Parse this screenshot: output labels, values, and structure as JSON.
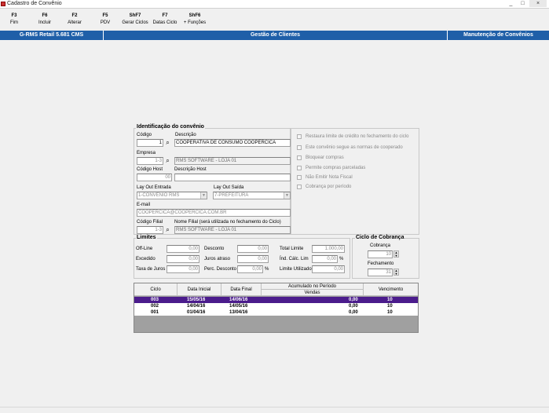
{
  "window": {
    "title": "Cadastro de Convênio",
    "controls": [
      "_",
      "□",
      "×"
    ]
  },
  "toolbar": [
    {
      "key": "F3",
      "label": "Fim"
    },
    {
      "key": "F6",
      "label": "Incluir"
    },
    {
      "key": "F2",
      "label": "Alterar"
    },
    {
      "key": "F5",
      "label": "PDV"
    },
    {
      "key": "ShF7",
      "label": "Gerar Ciclos"
    },
    {
      "key": "F7",
      "label": "Datas Ciclo"
    },
    {
      "key": "ShF6",
      "label": "+ Funções"
    }
  ],
  "bluebar": {
    "app": "G-RMS Retail 5.681 CMS",
    "module": "Gestão de Clientes",
    "screen": "Manutenção de Convênios"
  },
  "ident": {
    "title": "Identificação do convênio",
    "codigo_label": "Código",
    "codigo_value": "1",
    "descricao_label": "Descrição",
    "descricao_value": "COOPERATIVA DE CONSUMO COOPERCICA",
    "empresa_label": "Empresa",
    "empresa_code": "1-3",
    "empresa_name": "RMS SOFTWARE - LOJA 01",
    "codigo_host_label": "Código Host",
    "codigo_host_value": "00",
    "descricao_host_label": "Descrição Host",
    "descricao_host_value": "",
    "layout_entrada_label": "Lay Out Entrada",
    "layout_entrada_value": "1-CONVENIO RMS",
    "layout_saida_label": "Lay Out Saída",
    "layout_saida_value": "7-PREFEITURA",
    "email_label": "E-mail",
    "email_value": "COOPERCICA@COOPERCICA.COM.BR",
    "filial_label": "Código Filial",
    "filial_code": "1-3",
    "filial_name_label": "Nome Filial (será utilizada no fechamento do Ciclo)",
    "filial_name": "RMS SOFTWARE - LOJA 01"
  },
  "options": [
    "Restaura limite de crédito no fechamento do ciclo",
    "Este convênio segue as normas de cooperado",
    "Bloquear compras",
    "Permite compras parceladas",
    "Não Emitir Nota Fiscal",
    "Cobrança por período"
  ],
  "limites": {
    "title": "Limites",
    "offline_label": "Off-Line",
    "offline_value": "0,00",
    "desconto_label": "Desconto",
    "desconto_value": "0,00",
    "total_limite_label": "Total Limite",
    "total_limite_value": "1.000,00",
    "excedido_label": "Excedido",
    "excedido_value": "0,00",
    "juros_atraso_label": "Juros atraso",
    "juros_atraso_value": "0,00",
    "ind_calc_label": "Índ. Cálc. Lim",
    "ind_calc_value": "0,00",
    "ind_calc_unit": "%",
    "taxa_juros_label": "Taxa de Juros",
    "taxa_juros_value": "0,00",
    "perc_desconto_label": "Perc. Desconto",
    "perc_desconto_value": "0,00",
    "perc_desconto_unit": "%",
    "limite_utilizado_label": "Limite Utilizado",
    "limite_utilizado_value": "0,00"
  },
  "ciclo_cobranca": {
    "title": "Ciclo de Cobrança",
    "cobranca_label": "Cobrança",
    "cobranca_value": "10",
    "fechamento_label": "Fechamento",
    "fechamento_value": "31"
  },
  "grid": {
    "headers": {
      "ciclo": "Ciclo",
      "data_inicial": "Data Inicial",
      "data_final": "Data Final",
      "acumulado": "Acumulado no Período",
      "vendas": "Vendas",
      "vencimento": "Vencimento"
    },
    "rows": [
      {
        "ciclo": "003",
        "data_inicial": "15/05/16",
        "data_final": "14/06/16",
        "vendas": "0,00",
        "vencimento": "10",
        "selected": true
      },
      {
        "ciclo": "002",
        "data_inicial": "14/04/16",
        "data_final": "14/05/16",
        "vendas": "0,00",
        "vencimento": "10",
        "selected": false
      },
      {
        "ciclo": "001",
        "data_inicial": "01/04/16",
        "data_final": "13/04/16",
        "vendas": "0,00",
        "vencimento": "10",
        "selected": false
      }
    ]
  },
  "colors": {
    "blue_bar": "#1f5fa8",
    "selected_row": "#4b1c8c"
  }
}
